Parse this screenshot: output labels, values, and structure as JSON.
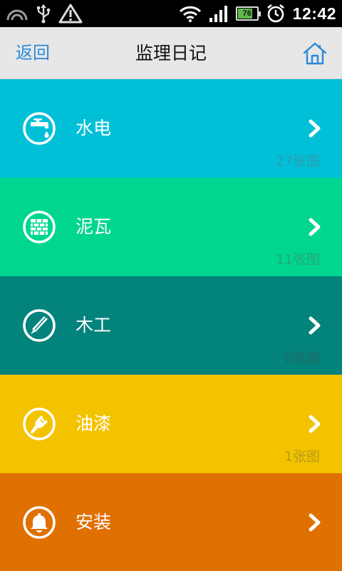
{
  "status_bar": {
    "icons": [
      "circle-arc-icon",
      "usb-icon",
      "warning-icon",
      "wifi-icon",
      "signal-icon",
      "battery-icon",
      "alarm-icon"
    ],
    "battery_level": "76",
    "time": "12:42"
  },
  "header": {
    "back_label": "返回",
    "title": "监理日记",
    "home_icon": "home-icon",
    "accent": "#2b8ad8"
  },
  "categories": [
    {
      "label": "水电",
      "count": "27张图",
      "color": "#00c0d8",
      "count_color": "#2f9bab",
      "icon": "faucet-icon"
    },
    {
      "label": "泥瓦",
      "count": "11张图",
      "color": "#00d68f",
      "count_color": "#26a877",
      "icon": "brick-wall-icon"
    },
    {
      "label": "木工",
      "count": "6张图",
      "color": "#02837b",
      "count_color": "#1f6b66",
      "icon": "saw-icon"
    },
    {
      "label": "油漆",
      "count": "1张图",
      "color": "#f3c300",
      "count_color": "#bc9a17",
      "icon": "paint-brush-icon"
    },
    {
      "label": "安装",
      "count": "",
      "color": "#e07000",
      "count_color": "#b05a0a",
      "icon": "bell-icon"
    }
  ]
}
